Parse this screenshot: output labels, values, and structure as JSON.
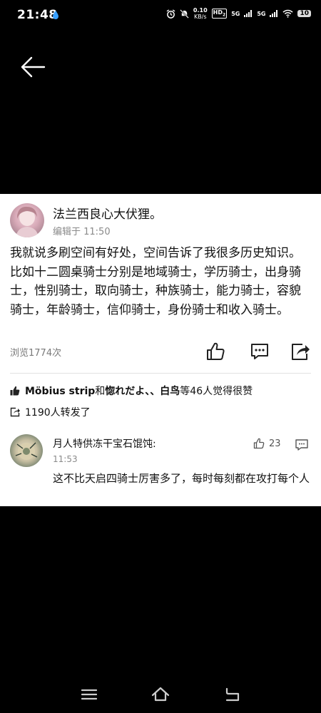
{
  "status_bar": {
    "time": "21:48",
    "net_speed_value": "0.10",
    "net_speed_unit": "KB/s",
    "hd_label": "HD",
    "hd_sub": "2",
    "signal1_label": "5G",
    "signal2_label": "5G",
    "battery": "10"
  },
  "post": {
    "author": "法兰西良心大伏狸。",
    "edited": "编辑于 11:50",
    "body": "我就说多刷空间有好处，空间告诉了我很多历史知识。比如十二圆桌骑士分别是地域骑士，学历骑士，出身骑士，性别骑士，取向骑士，种族骑士，能力骑士，容貌骑士，年龄骑士，信仰骑士，身份骑士和收入骑士。",
    "views": "浏览1774次"
  },
  "likes": {
    "user1": "Möbius strip",
    "and": "和",
    "user2": "惚れだよ、、",
    "user3": "白鸟",
    "suffix": "等46人觉得很赞"
  },
  "reposts": {
    "text": "1190人转发了"
  },
  "comment": {
    "author": "月人特供冻干宝石馄饨:",
    "time": "11:53",
    "like_count": "23",
    "text": "这不比天启四骑士厉害多了，每时每刻都在攻打每个人"
  },
  "colors": {
    "background": "#000000",
    "card": "#ffffff",
    "text": "#111111",
    "muted": "#8a8a8a"
  },
  "icons": [
    "back-arrow-icon",
    "like-icon",
    "comment-icon",
    "share-icon",
    "thumb-up-icon",
    "repost-icon",
    "reply-icon",
    "menu-icon",
    "home-icon",
    "return-icon"
  ]
}
